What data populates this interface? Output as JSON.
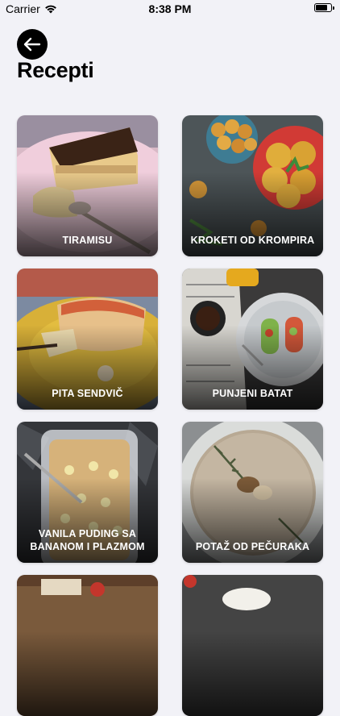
{
  "status_bar": {
    "carrier": "Carrier",
    "time": "8:38 PM",
    "battery_level": 0.75,
    "icons": [
      "wifi-icon",
      "battery-icon"
    ]
  },
  "header": {
    "back_icon": "arrow-left-icon",
    "title": "Recepti"
  },
  "recipes": [
    {
      "label": "TIRAMISU"
    },
    {
      "label": "KROKETI OD KROMPIRA"
    },
    {
      "label": "PITA SENDVIČ"
    },
    {
      "label": "PUNJENI BATAT"
    },
    {
      "label": "VANILA PUDING SA\nBANANOM I PLAZMOM"
    },
    {
      "label": "POTAŽ OD PEČURAKA"
    },
    {
      "label": ""
    },
    {
      "label": ""
    }
  ]
}
